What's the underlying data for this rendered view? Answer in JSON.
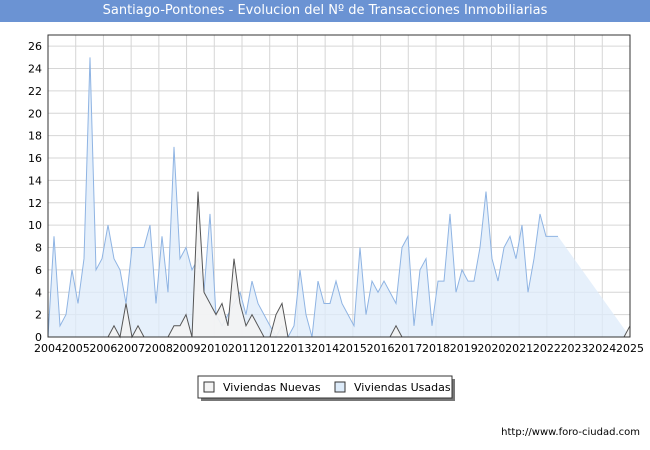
{
  "title": "Santiago-Pontones - Evolucion del Nº de Transacciones Inmobiliarias",
  "footer": "http://www.foro-ciudad.com",
  "colors": {
    "title_bg": "#6b93d3",
    "usadas_fill": "#ddebf9",
    "usadas_line": "#8fb4e3",
    "nuevas_fill": "#f3f3f3",
    "nuevas_line": "#555555"
  },
  "chart_data": {
    "type": "area",
    "title": "Santiago-Pontones - Evolucion del Nº de Transacciones Inmobiliarias",
    "x_label": "",
    "y_label": "",
    "x_ticks": [
      "2004",
      "2005",
      "2006",
      "2007",
      "2008",
      "2009",
      "2010",
      "2011",
      "2012",
      "2013",
      "2014",
      "2015",
      "2016",
      "2017",
      "2018",
      "2019",
      "2020",
      "2021",
      "2022",
      "2023",
      "2024",
      "2025"
    ],
    "y_ticks": [
      0,
      2,
      4,
      6,
      8,
      10,
      12,
      14,
      16,
      18,
      20,
      22,
      24,
      26
    ],
    "ylim": [
      0,
      27
    ],
    "x_range": [
      "2004-Q1",
      "2025-Q2"
    ],
    "grid": true,
    "legend_position": "bottom-center",
    "series": [
      {
        "name": "Viviendas Nuevas",
        "values": [
          0,
          0,
          0,
          0,
          0,
          0,
          0,
          0,
          0,
          0,
          0,
          1,
          0,
          3,
          0,
          1,
          0,
          0,
          0,
          0,
          0,
          1,
          1,
          2,
          0,
          13,
          4,
          3,
          2,
          3,
          1,
          7,
          3,
          1,
          2,
          1,
          0,
          0,
          2,
          3,
          0,
          0,
          0,
          0,
          0,
          0,
          0,
          0,
          0,
          0,
          0,
          0,
          0,
          0,
          0,
          0,
          0,
          0,
          1,
          0,
          0,
          0,
          0,
          0,
          0,
          0,
          0,
          0,
          0,
          0,
          0,
          0,
          0,
          0,
          0,
          0,
          0,
          0,
          0,
          0,
          0,
          0,
          0,
          0,
          0,
          0,
          0,
          0,
          0,
          0,
          0,
          0,
          0,
          0,
          0,
          0,
          0,
          1
        ]
      },
      {
        "name": "Viviendas Usadas",
        "values": [
          0,
          9,
          1,
          2,
          6,
          3,
          7,
          25,
          6,
          7,
          10,
          7,
          6,
          3,
          8,
          8,
          8,
          10,
          3,
          9,
          4,
          17,
          7,
          8,
          6,
          7,
          4,
          11,
          2,
          1,
          2,
          3,
          4,
          2,
          5,
          3,
          2,
          1,
          0,
          1,
          0,
          1,
          6,
          2,
          0,
          5,
          3,
          3,
          5,
          3,
          2,
          1,
          8,
          2,
          5,
          4,
          5,
          4,
          3,
          8,
          9,
          1,
          6,
          7,
          1,
          5,
          5,
          11,
          4,
          6,
          5,
          5,
          8,
          13,
          7,
          5,
          8,
          9,
          7,
          10,
          4,
          7,
          11,
          9,
          9,
          9
        ]
      }
    ]
  }
}
